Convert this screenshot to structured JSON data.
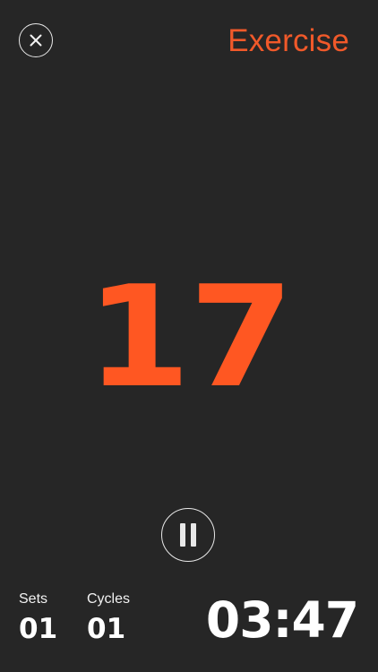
{
  "header": {
    "close_icon": "close-icon",
    "phase_title": "Exercise"
  },
  "timer": {
    "countdown": "17",
    "pause_icon": "pause-icon"
  },
  "footer": {
    "sets_label": "Sets",
    "sets_value": "01",
    "cycles_label": "Cycles",
    "cycles_value": "01",
    "total_time": "03:47"
  },
  "colors": {
    "background": "#262626",
    "accent": "#ff5722",
    "text": "#ffffff"
  }
}
